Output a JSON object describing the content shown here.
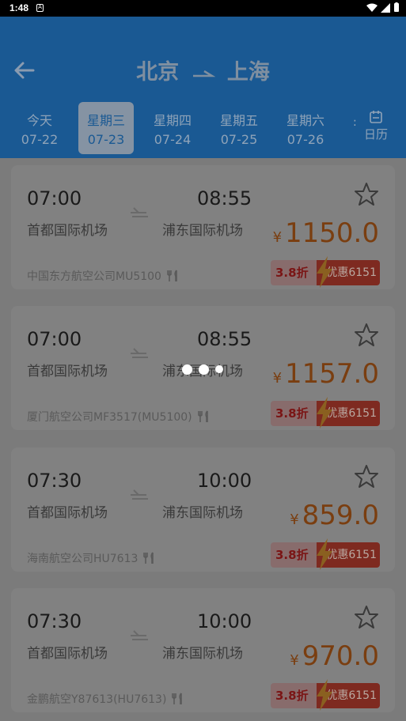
{
  "status_bar": {
    "time": "1:48",
    "notif_glyph": "A"
  },
  "header": {
    "origin": "北京",
    "destination": "上海",
    "dates": [
      {
        "weekday": "今天",
        "date": "07-22"
      },
      {
        "weekday": "星期三",
        "date": "07-23",
        "selected": true
      },
      {
        "weekday": "星期四",
        "date": "07-24"
      },
      {
        "weekday": "星期五",
        "date": "07-25"
      },
      {
        "weekday": "星期六",
        "date": "07-26"
      }
    ],
    "separator": ":",
    "calendar_label": "日历"
  },
  "flights": [
    {
      "dep_time": "07:00",
      "arr_time": "08:55",
      "dep_airport": "首都国际机场",
      "arr_airport": "浦东国际机场",
      "currency": "¥",
      "price": "1150.0",
      "airline": "中国东方航空公司MU5100",
      "discount": "3.8折",
      "promo": "优惠6151"
    },
    {
      "dep_time": "07:00",
      "arr_time": "08:55",
      "dep_airport": "首都国际机场",
      "arr_airport": "浦东国际机场",
      "currency": "¥",
      "price": "1157.0",
      "airline": "厦门航空公司MF3517(MU5100)",
      "discount": "3.8折",
      "promo": "优惠6151"
    },
    {
      "dep_time": "07:30",
      "arr_time": "10:00",
      "dep_airport": "首都国际机场",
      "arr_airport": "浦东国际机场",
      "currency": "¥",
      "price": "859.0",
      "airline": "海南航空公司HU7613",
      "discount": "3.8折",
      "promo": "优惠6151"
    },
    {
      "dep_time": "07:30",
      "arr_time": "10:00",
      "dep_airport": "首都国际机场",
      "arr_airport": "浦东国际机场",
      "currency": "¥",
      "price": "970.0",
      "airline": "金鹏航空Y87613(HU7613)",
      "discount": "3.8折",
      "promo": "优惠6151"
    }
  ],
  "icons": {
    "back": "arrow-left-icon",
    "route_arrow": "arrow-right-icon",
    "calendar": "calendar-icon",
    "plane": "plane-icon",
    "favorite": "star-icon",
    "meal": "meal-icon",
    "loading": "loading-dots-icon"
  },
  "colors": {
    "header": "#1a5993",
    "price": "#7a3e10",
    "promo_red": "#7e2a20"
  }
}
